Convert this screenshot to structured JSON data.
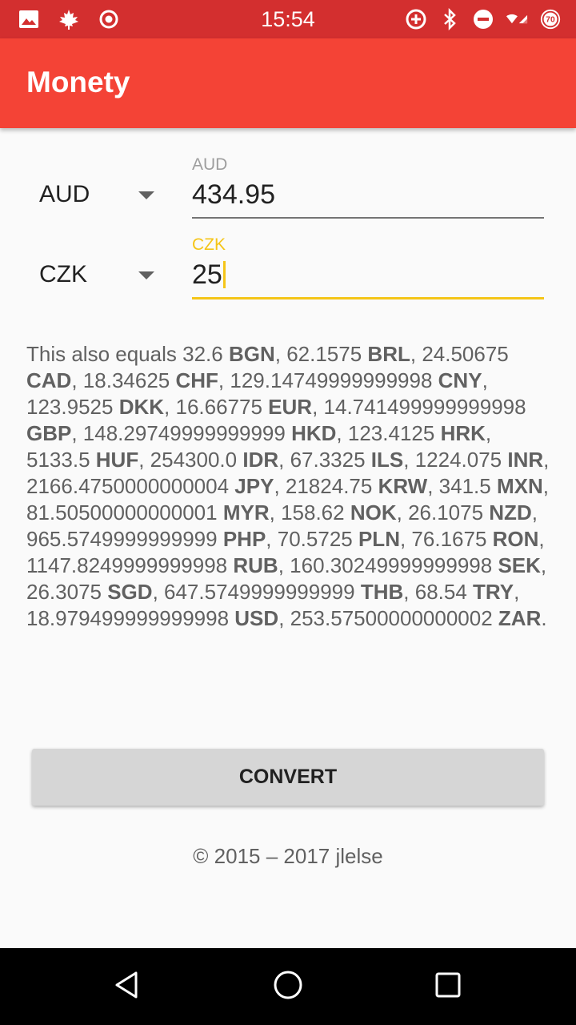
{
  "status_bar": {
    "time": "15:54",
    "left_icons": [
      "image-icon",
      "maple-leaf-icon",
      "record-icon"
    ],
    "right_icons": [
      "data-saver-icon",
      "bluetooth-icon",
      "do-not-disturb-icon",
      "signal-icon",
      "speed-badge-icon"
    ],
    "speed_badge": "70"
  },
  "app_bar": {
    "title": "Monety",
    "color": "#f44336"
  },
  "converter": {
    "from": {
      "currency": "AUD",
      "label": "AUD",
      "value": "434.95"
    },
    "to": {
      "currency": "CZK",
      "label": "CZK",
      "value": "25"
    },
    "accent_color": "#f5c518"
  },
  "equals": {
    "prefix": "This also equals",
    "items": [
      {
        "amount": "32.6",
        "code": "BGN"
      },
      {
        "amount": "62.1575",
        "code": "BRL"
      },
      {
        "amount": "24.50675",
        "code": "CAD"
      },
      {
        "amount": "18.34625",
        "code": "CHF"
      },
      {
        "amount": "129.14749999999998",
        "code": "CNY"
      },
      {
        "amount": "123.9525",
        "code": "DKK"
      },
      {
        "amount": "16.66775",
        "code": "EUR"
      },
      {
        "amount": "14.741499999999998",
        "code": "GBP"
      },
      {
        "amount": "148.29749999999999",
        "code": "HKD"
      },
      {
        "amount": "123.4125",
        "code": "HRK"
      },
      {
        "amount": "5133.5",
        "code": "HUF"
      },
      {
        "amount": "254300.0",
        "code": "IDR"
      },
      {
        "amount": "67.3325",
        "code": "ILS"
      },
      {
        "amount": "1224.075",
        "code": "INR"
      },
      {
        "amount": "2166.4750000000004",
        "code": "JPY"
      },
      {
        "amount": "21824.75",
        "code": "KRW"
      },
      {
        "amount": "341.5",
        "code": "MXN"
      },
      {
        "amount": "81.50500000000001",
        "code": "MYR"
      },
      {
        "amount": "158.62",
        "code": "NOK"
      },
      {
        "amount": "26.1075",
        "code": "NZD"
      },
      {
        "amount": "965.5749999999999",
        "code": "PHP"
      },
      {
        "amount": "70.5725",
        "code": "PLN"
      },
      {
        "amount": "76.1675",
        "code": "RON"
      },
      {
        "amount": "1147.8249999999998",
        "code": "RUB"
      },
      {
        "amount": "160.30249999999998",
        "code": "SEK"
      },
      {
        "amount": "26.3075",
        "code": "SGD"
      },
      {
        "amount": "647.5749999999999",
        "code": "THB"
      },
      {
        "amount": "68.54",
        "code": "TRY"
      },
      {
        "amount": "18.979499999999998",
        "code": "USD"
      },
      {
        "amount": "253.57500000000002",
        "code": "ZAR"
      }
    ]
  },
  "convert_button": {
    "label": "CONVERT"
  },
  "footer": {
    "text": "© 2015 – 2017 jlelse"
  },
  "nav_bar": {
    "buttons": [
      "back-icon",
      "home-icon",
      "recents-icon"
    ]
  }
}
